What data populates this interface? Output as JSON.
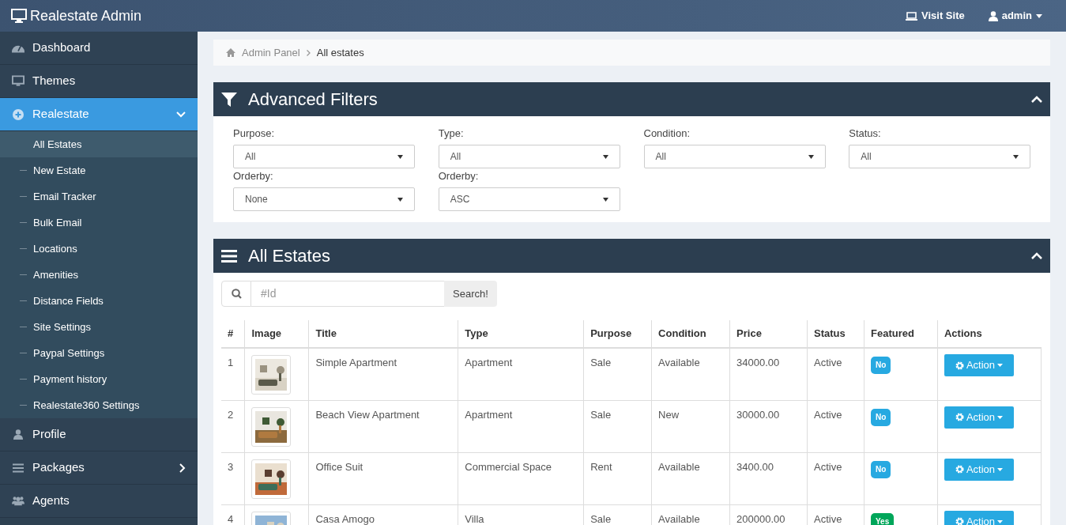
{
  "header": {
    "brand": "Realestate Admin",
    "links": [
      {
        "label": "Visit Site",
        "caret": false
      },
      {
        "label": "admin",
        "caret": true
      }
    ]
  },
  "sidebar": {
    "items": [
      {
        "label": "Dashboard",
        "selected": false
      },
      {
        "label": "Themes",
        "selected": false
      },
      {
        "label": "Realestate",
        "selected": true,
        "expanded": true,
        "children": [
          {
            "label": "All Estates",
            "selected": true
          },
          {
            "label": "New Estate",
            "selected": false
          },
          {
            "label": "Email Tracker",
            "selected": false
          },
          {
            "label": "Bulk Email",
            "selected": false
          },
          {
            "label": "Locations",
            "selected": false
          },
          {
            "label": "Amenities",
            "selected": false
          },
          {
            "label": "Distance Fields",
            "selected": false
          },
          {
            "label": "Site Settings",
            "selected": false
          },
          {
            "label": "Paypal Settings",
            "selected": false
          },
          {
            "label": "Payment history",
            "selected": false
          },
          {
            "label": "Realestate360 Settings",
            "selected": false
          }
        ]
      },
      {
        "label": "Profile",
        "selected": false
      },
      {
        "label": "Packages",
        "selected": false,
        "expanded": false
      },
      {
        "label": "Agents",
        "selected": false
      }
    ]
  },
  "breadcrumb": [
    "Admin Panel",
    "All estates"
  ],
  "filters_panel": {
    "title": "Advanced Filters",
    "fields": [
      {
        "label": "Purpose:",
        "value": "All"
      },
      {
        "label": "Type:",
        "value": "All"
      },
      {
        "label": "Condition:",
        "value": "All"
      },
      {
        "label": "Status:",
        "value": "All"
      },
      {
        "label": "Orderby:",
        "value": "None"
      },
      {
        "label": "Orderby:",
        "value": "ASC"
      }
    ]
  },
  "estates_panel": {
    "title": "All Estates",
    "search": {
      "placeholder": "#Id",
      "button": "Search!"
    },
    "table": {
      "columns": [
        "#",
        "Image",
        "Title",
        "Type",
        "Purpose",
        "Condition",
        "Price",
        "Status",
        "Featured",
        "Actions"
      ],
      "rows": [
        {
          "id": "1",
          "title": "Simple Apartment",
          "type": "Apartment",
          "purpose": "Sale",
          "condition": "Available",
          "price": "34000.00",
          "status": "Active",
          "featured": false,
          "featured_label": "No",
          "action": "Action"
        },
        {
          "id": "2",
          "title": "Beach View Apartment",
          "type": "Apartment",
          "purpose": "Sale",
          "condition": "New",
          "price": "30000.00",
          "status": "Active",
          "featured": false,
          "featured_label": "No",
          "action": "Action"
        },
        {
          "id": "3",
          "title": "Office Suit",
          "type": "Commercial Space",
          "purpose": "Rent",
          "condition": "Available",
          "price": "3400.00",
          "status": "Active",
          "featured": false,
          "featured_label": "No",
          "action": "Action"
        },
        {
          "id": "4",
          "title": "Casa Amogo",
          "type": "Villa",
          "purpose": "Sale",
          "condition": "Available",
          "price": "200000.00",
          "status": "Active",
          "featured": true,
          "featured_label": "Yes",
          "action": "Action"
        }
      ]
    }
  }
}
